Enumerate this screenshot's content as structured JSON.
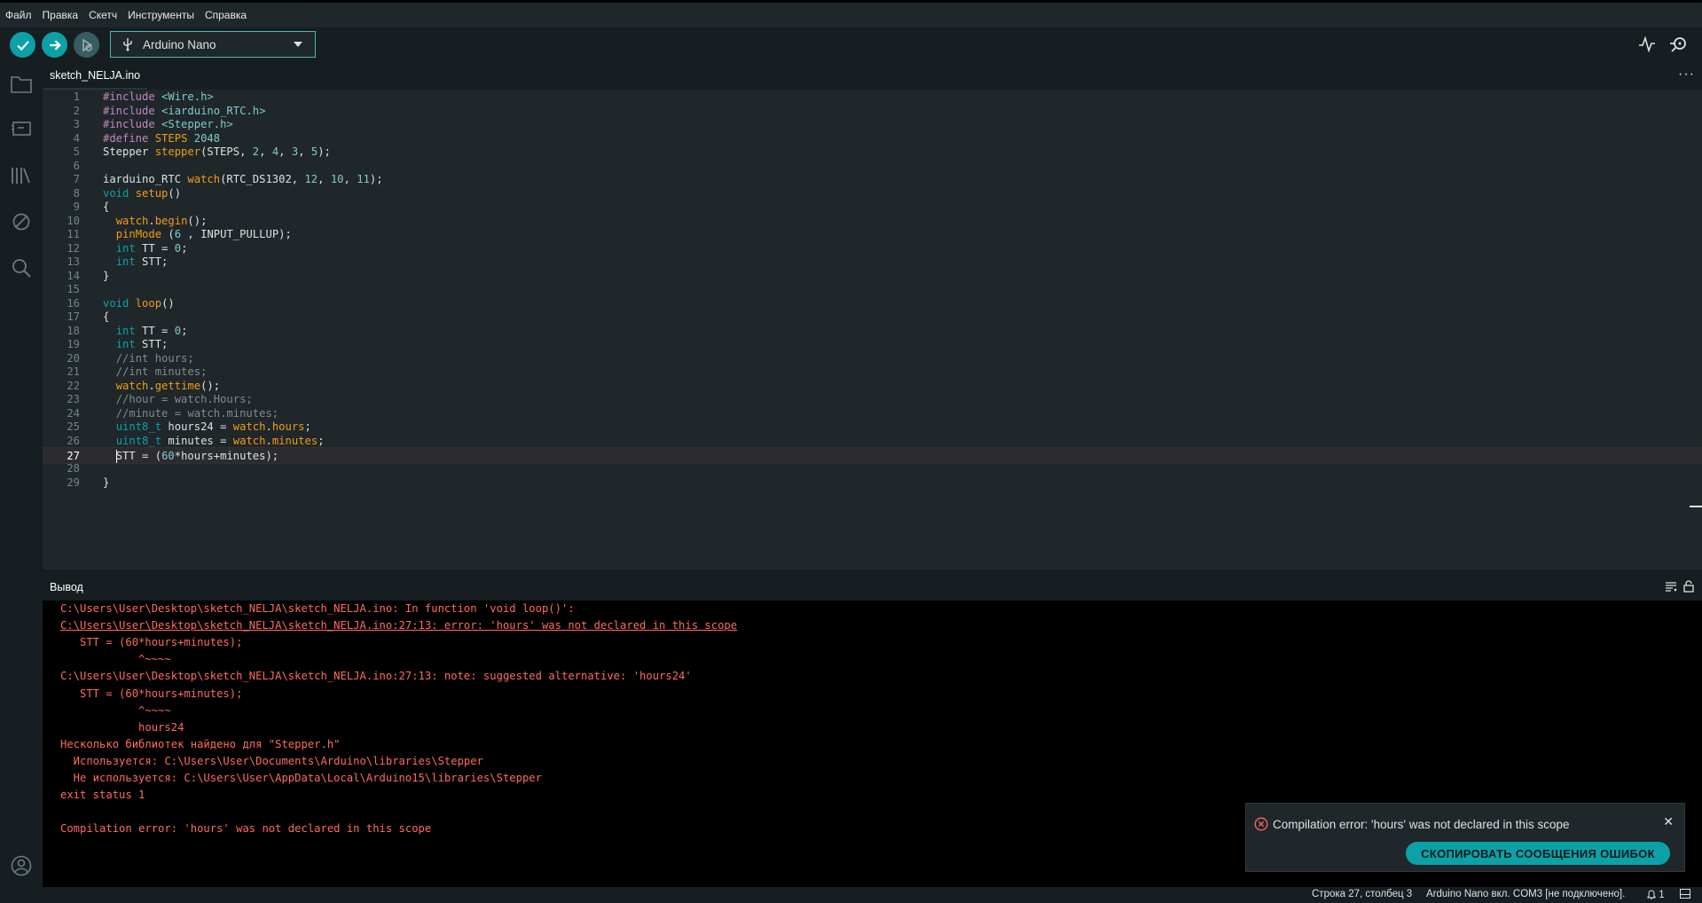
{
  "menu": [
    "Файл",
    "Правка",
    "Скетч",
    "Инструменты",
    "Справка"
  ],
  "toolbar": {
    "verify_icon": "checkmark-icon",
    "upload_icon": "arrow-right-icon",
    "debug_icon": "debug-icon",
    "board": "Arduino Nano",
    "serial_plotter_icon": "plotter-icon",
    "serial_monitor_icon": "monitor-icon"
  },
  "sidebar": [
    "folder-icon",
    "board-icon",
    "library-icon",
    "debug-icon",
    "search-icon",
    "account-icon"
  ],
  "tab": {
    "name": "sketch_NELJA.ino",
    "more": "···"
  },
  "code": [
    {
      "n": "1",
      "html": "<span class=\"kw\">#include</span> <span class=\"str\">&lt;Wire.h&gt;</span>"
    },
    {
      "n": "2",
      "html": "<span class=\"kw\">#include</span> <span class=\"str\">&lt;iarduino_RTC.h&gt;</span>"
    },
    {
      "n": "3",
      "html": "<span class=\"kw\">#include</span> <span class=\"str\">&lt;Stepper.h&gt;</span>"
    },
    {
      "n": "4",
      "html": "<span class=\"kw\">#define</span> <span class=\"fn\">STEPS</span> <span class=\"num\">2048</span>"
    },
    {
      "n": "5",
      "html": "Stepper <span class=\"fn\">stepper</span>(STEPS, <span class=\"num\">2</span>, <span class=\"num\">4</span>, <span class=\"num\">3</span>, <span class=\"num\">5</span>);"
    },
    {
      "n": "6",
      "html": ""
    },
    {
      "n": "7",
      "html": "iarduino_RTC <span class=\"fn\">watch</span>(RTC_DS1302, <span class=\"num\">12</span>, <span class=\"num\">10</span>, <span class=\"num\">11</span>);"
    },
    {
      "n": "8",
      "html": "<span class=\"ty\">void</span> <span class=\"fn\">setup</span>()"
    },
    {
      "n": "9",
      "html": "{"
    },
    {
      "n": "10",
      "html": "  <span class=\"fn\">watch</span>.<span class=\"fn\">begin</span>();"
    },
    {
      "n": "11",
      "html": "  <span class=\"fn\">pinMode</span> (<span class=\"num\">6</span> , INPUT_PULLUP);"
    },
    {
      "n": "12",
      "html": "  <span class=\"ty\">int</span> TT = <span class=\"num\">0</span>;"
    },
    {
      "n": "13",
      "html": "  <span class=\"ty\">int</span> STT;"
    },
    {
      "n": "14",
      "html": "}"
    },
    {
      "n": "15",
      "html": ""
    },
    {
      "n": "16",
      "html": "<span class=\"ty\">void</span> <span class=\"fn\">loop</span>()"
    },
    {
      "n": "17",
      "html": "{"
    },
    {
      "n": "18",
      "html": "  <span class=\"ty\">int</span> TT = <span class=\"num\">0</span>;"
    },
    {
      "n": "19",
      "html": "  <span class=\"ty\">int</span> STT;"
    },
    {
      "n": "20",
      "html": "  <span class=\"cm\">//int hours;</span>"
    },
    {
      "n": "21",
      "html": "  <span class=\"cm\">//int minutes;</span>"
    },
    {
      "n": "22",
      "html": "  <span class=\"fn\">watch</span>.<span class=\"fn\">gettime</span>();"
    },
    {
      "n": "23",
      "html": "  <span class=\"cm\">//hour = watch.Hours;</span>"
    },
    {
      "n": "24",
      "html": "  <span class=\"cm\">//minute = watch.minutes;</span>"
    },
    {
      "n": "25",
      "html": "  <span class=\"ty\">uint8_t</span> hours24 = <span class=\"fn\">watch</span>.<span class=\"mem\">hours</span>;"
    },
    {
      "n": "26",
      "html": "  <span class=\"ty\">uint8_t</span> minutes = <span class=\"fn\">watch</span>.<span class=\"mem\">minutes</span>;"
    },
    {
      "n": "27",
      "html": "  <i class=\"caret\"></i>STT = (<span class=\"num\">60</span>*hours+minutes);",
      "current": true
    },
    {
      "n": "28",
      "html": ""
    },
    {
      "n": "29",
      "html": "}"
    }
  ],
  "output": {
    "title": "Вывод",
    "lines": [
      "C:\\Users\\User\\Desktop\\sketch_NELJA\\sketch_NELJA.ino: In function 'void loop()':",
      "C:\\Users\\User\\Desktop\\sketch_NELJA\\sketch_NELJA.ino:27:13: error: 'hours' was not declared in this scope",
      "   STT = (60*hours+minutes);",
      "            ^~~~~",
      "C:\\Users\\User\\Desktop\\sketch_NELJA\\sketch_NELJA.ino:27:13: note: suggested alternative: 'hours24'",
      "   STT = (60*hours+minutes);",
      "            ^~~~~",
      "            hours24",
      "Несколько библиотек найдено для \"Stepper.h\"",
      "  Используется: C:\\Users\\User\\Documents\\Arduino\\libraries\\Stepper",
      "  Не используется: C:\\Users\\User\\AppData\\Local\\Arduino15\\libraries\\Stepper",
      "exit status 1",
      "",
      "Compilation error: 'hours' was not declared in this scope"
    ]
  },
  "notification": {
    "icon": "error-circle-icon",
    "message": "Compilation error: 'hours' was not declared in this scope",
    "close": "✕",
    "button": "СКОПИРОВАТЬ СООБЩЕНИЯ ОШИБОК"
  },
  "status": {
    "position": "Строка 27, столбец 3",
    "board": "Arduino Nano вкл. COM3 [не подключено].",
    "notifications_count": "1"
  },
  "colors": {
    "accent": "#0ca1a6",
    "error": "#ff6b5f",
    "editor_bg": "#1f272a"
  }
}
